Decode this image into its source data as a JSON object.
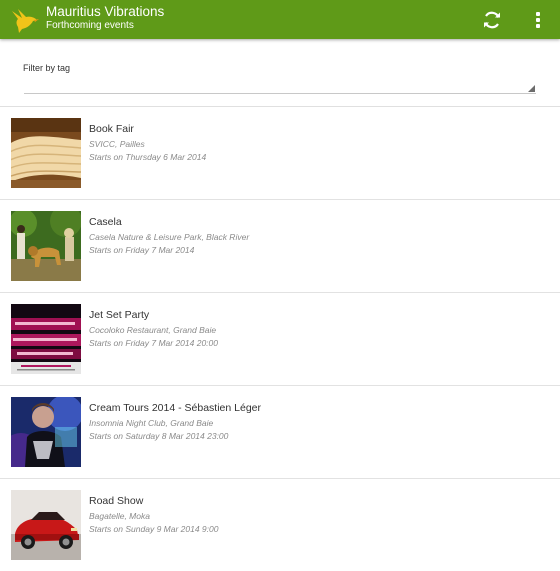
{
  "app": {
    "title": "Mauritius Vibrations",
    "subtitle": "Forthcoming events",
    "accent_color": "#5f9a18",
    "logo_icon": "bird-logo-icon",
    "refresh_icon": "refresh-icon",
    "overflow_icon": "overflow-menu-icon"
  },
  "filter": {
    "label": "Filter by tag",
    "value": ""
  },
  "events": [
    {
      "title": "Book Fair",
      "location": "SVICC, Pailles",
      "date": "Starts on Thursday 6 Mar 2014",
      "thumbnail": "open-book-image"
    },
    {
      "title": "Casela",
      "location": "Casela Nature & Leisure Park, Black River",
      "date": "Starts on Friday 7 Mar 2014",
      "thumbnail": "lion-walk-image"
    },
    {
      "title": "Jet Set Party",
      "location": "Cocoloko Restaurant, Grand Baie",
      "date": "Starts on Friday 7 Mar 2014 20:00",
      "thumbnail": "party-flyer-image"
    },
    {
      "title": "Cream Tours 2014 - Sébastien Léger",
      "location": "Insomnia Night Club, Grand Baie",
      "date": "Starts on Saturday 8 Mar 2014 23:00",
      "thumbnail": "dj-photo-image"
    },
    {
      "title": "Road Show",
      "location": "Bagatelle, Moka",
      "date": "Starts on Sunday 9 Mar 2014 9:00",
      "thumbnail": "red-car-image"
    }
  ]
}
